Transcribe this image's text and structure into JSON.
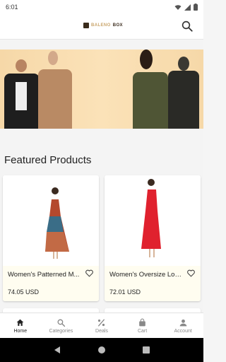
{
  "status_bar": {
    "time": "6:01"
  },
  "header": {
    "logo_part1": "BALENO",
    "logo_part2": "BOX"
  },
  "section": {
    "title": "Featured Products"
  },
  "products": [
    {
      "name": "Women's Patterned M...",
      "price": "74.05 USD"
    },
    {
      "name": "Women's Oversize Lon...",
      "price": "72.01 USD"
    }
  ],
  "bottom_nav": [
    {
      "label": "Home",
      "icon": "home-icon"
    },
    {
      "label": "Categories",
      "icon": "search-icon"
    },
    {
      "label": "Deals",
      "icon": "percent-icon"
    },
    {
      "label": "Cart",
      "icon": "shopping-bag-icon"
    },
    {
      "label": "Account",
      "icon": "account-icon"
    }
  ],
  "colors": {
    "banner_bg": "#f6d8a8",
    "brand_gold": "#c9a46a",
    "brand_dark": "#3a2b1c",
    "card_info_bg": "#fffdf0",
    "active_nav": "#222222",
    "inactive_nav": "#888888"
  }
}
